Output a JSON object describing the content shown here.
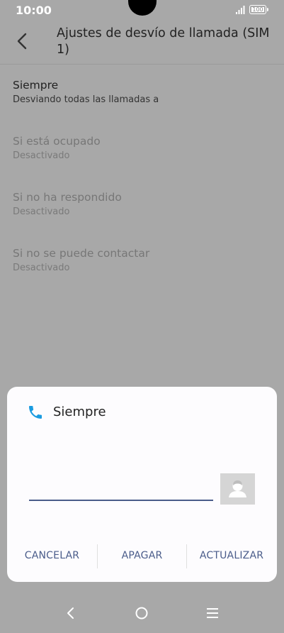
{
  "status_bar": {
    "time": "10:00",
    "battery": "100"
  },
  "app_bar": {
    "title": "Ajustes de desvío de llamada (SIM 1)"
  },
  "list": {
    "items": [
      {
        "title": "Siempre",
        "subtitle": "Desviando todas las llamadas a",
        "enabled": true
      },
      {
        "title": "Si está ocupado",
        "subtitle": "Desactivado",
        "enabled": false
      },
      {
        "title": "Si no ha respondido",
        "subtitle": "Desactivado",
        "enabled": false
      },
      {
        "title": "Si no se puede contactar",
        "subtitle": "Desactivado",
        "enabled": false
      }
    ]
  },
  "dialog": {
    "title": "Siempre",
    "input_value": "",
    "buttons": {
      "cancel": "CANCELAR",
      "turn_off": "APAGAR",
      "update": "ACTUALIZAR"
    }
  },
  "colors": {
    "accent": "#4a5c8a",
    "phone_icon": "#1a9be0",
    "scrim": "#a8a8a8",
    "dialog_bg": "#fdfcfe"
  }
}
